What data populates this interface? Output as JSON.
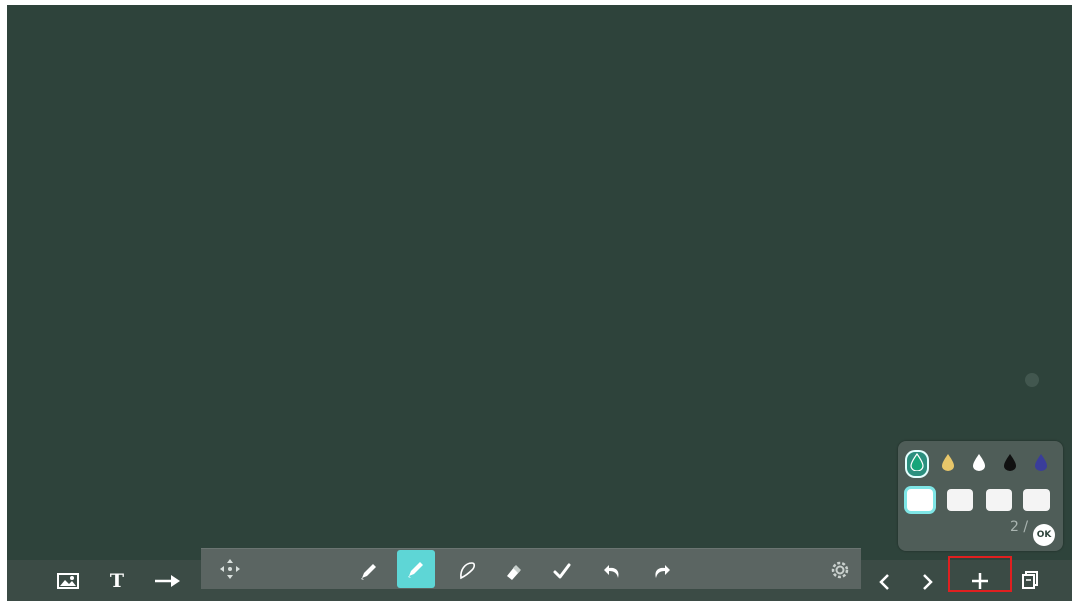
{
  "canvas": {
    "background": "#2e433b"
  },
  "left_tools": [
    {
      "name": "insert-image",
      "icon": "image-icon"
    },
    {
      "name": "insert-text",
      "icon": "text-icon",
      "glyph": "T"
    },
    {
      "name": "insert-arrow",
      "icon": "arrow-right-icon"
    }
  ],
  "draw_toolbar": {
    "tools": [
      {
        "name": "move",
        "icon": "move-icon"
      },
      {
        "name": "pencil",
        "icon": "pencil-icon"
      },
      {
        "name": "highlighter",
        "icon": "highlighter-icon",
        "active": true
      },
      {
        "name": "lasso",
        "icon": "lasso-icon"
      },
      {
        "name": "eraser",
        "icon": "eraser-icon"
      },
      {
        "name": "check",
        "icon": "check-icon"
      },
      {
        "name": "undo",
        "icon": "undo-icon"
      },
      {
        "name": "redo",
        "icon": "redo-icon"
      },
      {
        "name": "settings",
        "icon": "gear-icon"
      }
    ],
    "accent": "#5ed6d6"
  },
  "palette": {
    "colors": [
      "#2b8f7e",
      "#e8c76a",
      "#ffffff",
      "#111111",
      "#3a3d9a"
    ],
    "selected_color_index": 0,
    "sizes_selected_index": 0,
    "page_indicator": "2 /",
    "ok_label": "OK"
  },
  "navigation": {
    "prev_icon": "chevron-left-icon",
    "next_icon": "chevron-right-icon",
    "add_icon": "plus-icon",
    "pages_icon": "pages-icon"
  }
}
